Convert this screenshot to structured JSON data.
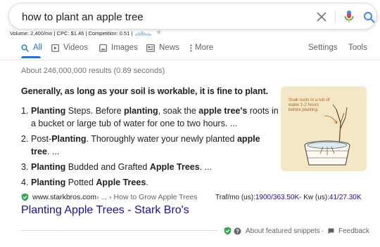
{
  "search": {
    "query": "how to plant an apple tree"
  },
  "icons": {
    "clear": "close-icon",
    "mic": "microphone-icon",
    "search": "search-icon"
  },
  "keyword_bar": {
    "text": "Volume: 2,400/mo | CPC: $1.46 | Competition: 0.51 |",
    "trend": [
      2,
      3,
      5,
      4,
      6,
      7,
      5,
      4,
      3,
      4,
      3,
      2
    ]
  },
  "tabs": {
    "all": "All",
    "videos": "Videos",
    "images": "Images",
    "news": "News",
    "more": "More",
    "settings": "Settings",
    "tools": "Tools"
  },
  "result_stats": "About 246,000,000 results (0.89 seconds)",
  "featured_snippet": {
    "heading": "Generally, as long as your soil is workable, it is fine to plant.",
    "items": [
      {
        "num": "1.",
        "parts": [
          {
            "t": "Planting",
            "b": true
          },
          {
            "t": " Steps. Before ",
            "b": false
          },
          {
            "t": "planting",
            "b": true
          },
          {
            "t": ", soak the ",
            "b": false
          },
          {
            "t": "apple tree's",
            "b": true
          },
          {
            "t": " roots in a bucket or large tub of water for one to two hours. ...",
            "b": false
          }
        ]
      },
      {
        "num": "2.",
        "parts": [
          {
            "t": "Post-",
            "b": false
          },
          {
            "t": "Planting",
            "b": true
          },
          {
            "t": ". Thoroughly water your newly planted ",
            "b": false
          },
          {
            "t": "apple tree",
            "b": true
          },
          {
            "t": ". ...",
            "b": false
          }
        ]
      },
      {
        "num": "3.",
        "parts": [
          {
            "t": "Planting",
            "b": true
          },
          {
            "t": " Budded and Grafted ",
            "b": false
          },
          {
            "t": "Apple Trees",
            "b": true
          },
          {
            "t": ". ...",
            "b": false
          }
        ]
      },
      {
        "num": "4.",
        "parts": [
          {
            "t": "Planting",
            "b": true
          },
          {
            "t": " Potted ",
            "b": false
          },
          {
            "t": "Apple Trees",
            "b": true
          },
          {
            "t": ".",
            "b": false
          }
        ]
      }
    ],
    "image_caption": "Soak roots in a tub of water 1-2 hours before planting."
  },
  "citation": {
    "domain": "www.starkbros.com",
    "path": " › ... › How to Grow Apple Trees",
    "traffic_label": "Traf/mo (us): ",
    "traffic_value": "1900/363.50K",
    "kw_label": " - Kw (us): ",
    "kw_value": "41/27.30K"
  },
  "result_title": "Planting Apple Trees - Stark Bro's",
  "footer": {
    "about": "About featured snippets",
    "feedback": "Feedback"
  },
  "colors": {
    "link": "#1a0dab",
    "accent": "#1a73e8",
    "shield": "#34a853"
  }
}
